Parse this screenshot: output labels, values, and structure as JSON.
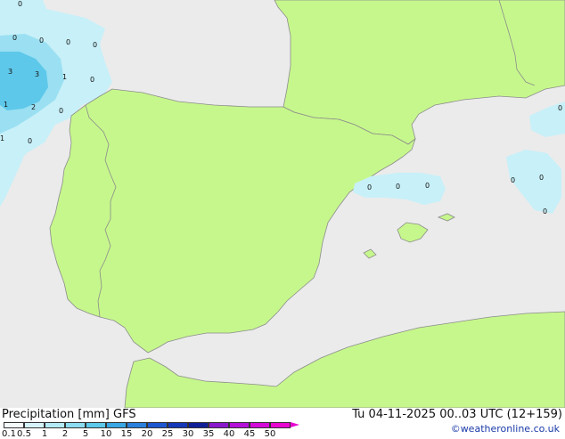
{
  "title": "Precipitation [mm]  GFS",
  "valid_time": "Tu 04-11-2025 00..03 UTC (12+159)",
  "credit": "©weatheronline.co.uk",
  "colors": {
    "sea": "#ebebeb",
    "land": "#c6f78c",
    "border": "#8c8c8c",
    "coast": "#8c8c8c",
    "precip_light": "#c8f0f8",
    "precip_mid": "#9ae0f2",
    "precip_heavy": "#5ec8ea"
  },
  "legend": {
    "ticks": [
      "0.1",
      "0.5",
      "1",
      "2",
      "5",
      "10",
      "15",
      "20",
      "25",
      "30",
      "35",
      "40",
      "45",
      "50"
    ],
    "colors": [
      "#f5fbfd",
      "#d6f3fa",
      "#b4eaf6",
      "#8cdcf1",
      "#5ec8ea",
      "#3aa6e4",
      "#2a80dc",
      "#1e58d0",
      "#1438b8",
      "#101e98",
      "#8a18cc",
      "#b410d8",
      "#d40ad8",
      "#e806d0"
    ]
  },
  "precip_values": [
    {
      "label": "0"
    },
    {
      "label": "0"
    },
    {
      "label": "0"
    },
    {
      "label": "0"
    },
    {
      "label": "0"
    },
    {
      "label": "3"
    },
    {
      "label": "3"
    },
    {
      "label": "1"
    },
    {
      "label": "0"
    },
    {
      "label": "1"
    },
    {
      "label": "2"
    },
    {
      "label": "0"
    },
    {
      "label": "1"
    },
    {
      "label": "0"
    },
    {
      "label": "0"
    },
    {
      "label": "0"
    },
    {
      "label": "0"
    },
    {
      "label": "0"
    },
    {
      "label": "0"
    },
    {
      "label": "0"
    },
    {
      "label": "0"
    }
  ]
}
